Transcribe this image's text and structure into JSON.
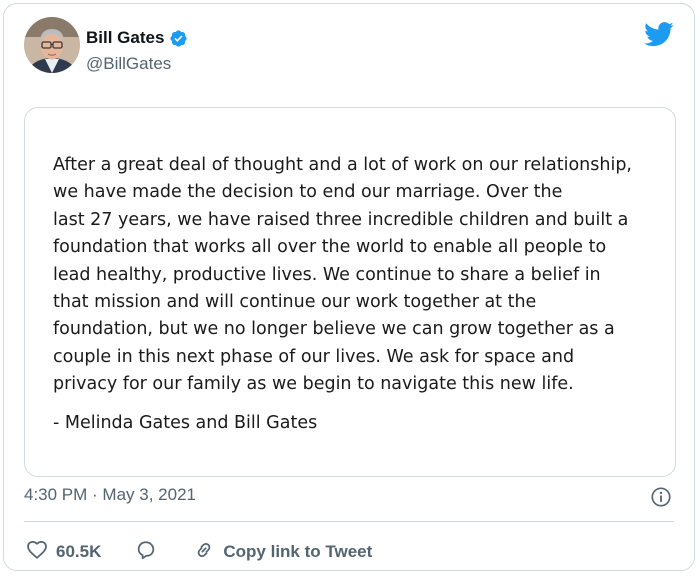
{
  "author": {
    "name": "Bill Gates",
    "handle": "@BillGates",
    "verified": true,
    "verified_color": "#1d9bf0"
  },
  "brand": {
    "logo_icon": "twitter-bird-icon",
    "color": "#1d9bf0"
  },
  "tweet": {
    "statement_lines": [
      "After a great deal of thought and a lot of work on our relationship,",
      "we have made the decision to end our marriage. Over the",
      "last 27 years, we have raised three incredible children and built a",
      "foundation that works all over the world to enable all people to",
      "lead healthy, productive lives. We continue to share a belief in",
      "that mission and will continue our work together at the",
      "foundation, but we no longer believe we can grow together as a",
      "couple in this next phase of our lives. We ask for space and",
      "privacy for our family as we begin to navigate this new life."
    ],
    "signature": "- Melinda Gates and Bill Gates",
    "timestamp": "4:30 PM · May 3, 2021"
  },
  "actions": {
    "like_icon": "heart-icon",
    "like_count": "60.5K",
    "reply_icon": "reply-icon",
    "copy_icon": "link-icon",
    "copy_label": "Copy link to Tweet"
  }
}
